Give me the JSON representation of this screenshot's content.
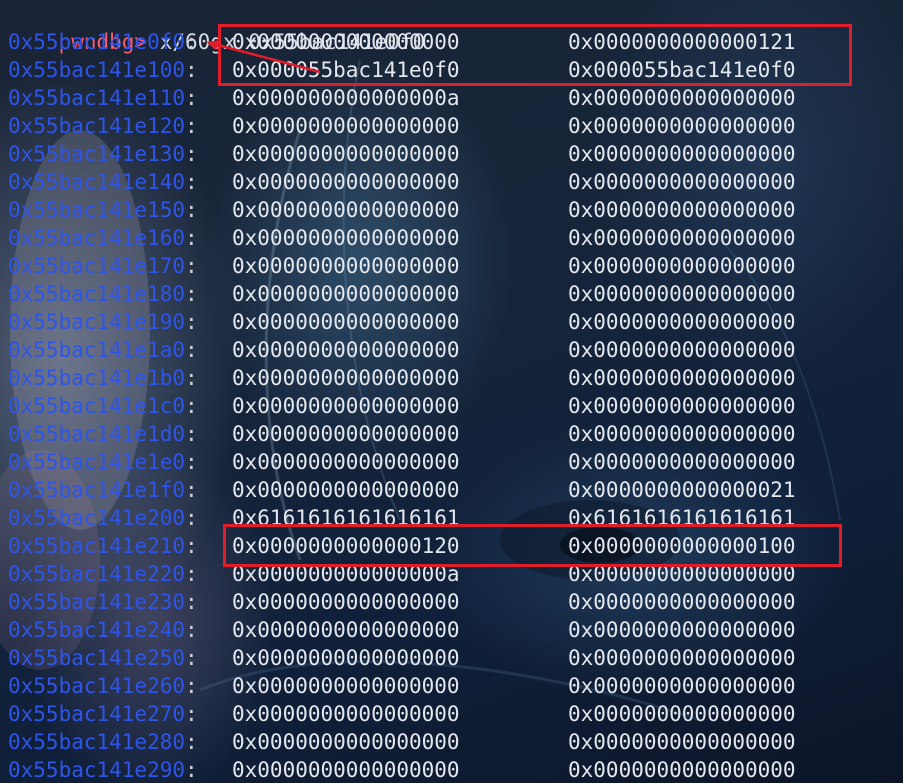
{
  "prompt": {
    "label": "pwndbg>",
    "command": " x/60gx 0x55bac141e0f0"
  },
  "memory_rows": [
    {
      "addr": "0x55bac141e0f0",
      "v1": "0x0000000000000000",
      "v2": "0x0000000000000121"
    },
    {
      "addr": "0x55bac141e100",
      "v1": "0x000055bac141e0f0",
      "v2": "0x000055bac141e0f0"
    },
    {
      "addr": "0x55bac141e110",
      "v1": "0x000000000000000a",
      "v2": "0x0000000000000000"
    },
    {
      "addr": "0x55bac141e120",
      "v1": "0x0000000000000000",
      "v2": "0x0000000000000000"
    },
    {
      "addr": "0x55bac141e130",
      "v1": "0x0000000000000000",
      "v2": "0x0000000000000000"
    },
    {
      "addr": "0x55bac141e140",
      "v1": "0x0000000000000000",
      "v2": "0x0000000000000000"
    },
    {
      "addr": "0x55bac141e150",
      "v1": "0x0000000000000000",
      "v2": "0x0000000000000000"
    },
    {
      "addr": "0x55bac141e160",
      "v1": "0x0000000000000000",
      "v2": "0x0000000000000000"
    },
    {
      "addr": "0x55bac141e170",
      "v1": "0x0000000000000000",
      "v2": "0x0000000000000000"
    },
    {
      "addr": "0x55bac141e180",
      "v1": "0x0000000000000000",
      "v2": "0x0000000000000000"
    },
    {
      "addr": "0x55bac141e190",
      "v1": "0x0000000000000000",
      "v2": "0x0000000000000000"
    },
    {
      "addr": "0x55bac141e1a0",
      "v1": "0x0000000000000000",
      "v2": "0x0000000000000000"
    },
    {
      "addr": "0x55bac141e1b0",
      "v1": "0x0000000000000000",
      "v2": "0x0000000000000000"
    },
    {
      "addr": "0x55bac141e1c0",
      "v1": "0x0000000000000000",
      "v2": "0x0000000000000000"
    },
    {
      "addr": "0x55bac141e1d0",
      "v1": "0x0000000000000000",
      "v2": "0x0000000000000000"
    },
    {
      "addr": "0x55bac141e1e0",
      "v1": "0x0000000000000000",
      "v2": "0x0000000000000000"
    },
    {
      "addr": "0x55bac141e1f0",
      "v1": "0x0000000000000000",
      "v2": "0x0000000000000021"
    },
    {
      "addr": "0x55bac141e200",
      "v1": "0x6161616161616161",
      "v2": "0x6161616161616161"
    },
    {
      "addr": "0x55bac141e210",
      "v1": "0x0000000000000120",
      "v2": "0x0000000000000100"
    },
    {
      "addr": "0x55bac141e220",
      "v1": "0x000000000000000a",
      "v2": "0x0000000000000000"
    },
    {
      "addr": "0x55bac141e230",
      "v1": "0x0000000000000000",
      "v2": "0x0000000000000000"
    },
    {
      "addr": "0x55bac141e240",
      "v1": "0x0000000000000000",
      "v2": "0x0000000000000000"
    },
    {
      "addr": "0x55bac141e250",
      "v1": "0x0000000000000000",
      "v2": "0x0000000000000000"
    },
    {
      "addr": "0x55bac141e260",
      "v1": "0x0000000000000000",
      "v2": "0x0000000000000000"
    },
    {
      "addr": "0x55bac141e270",
      "v1": "0x0000000000000000",
      "v2": "0x0000000000000000"
    },
    {
      "addr": "0x55bac141e280",
      "v1": "0x0000000000000000",
      "v2": "0x0000000000000000"
    },
    {
      "addr": "0x55bac141e290",
      "v1": "0x0000000000000000",
      "v2": "0x0000000000000000"
    }
  ],
  "colors": {
    "prompt": "#ff5c6a",
    "address": "#2f55e8",
    "value": "#e4e7ee",
    "annotation": "#e11d2a"
  }
}
